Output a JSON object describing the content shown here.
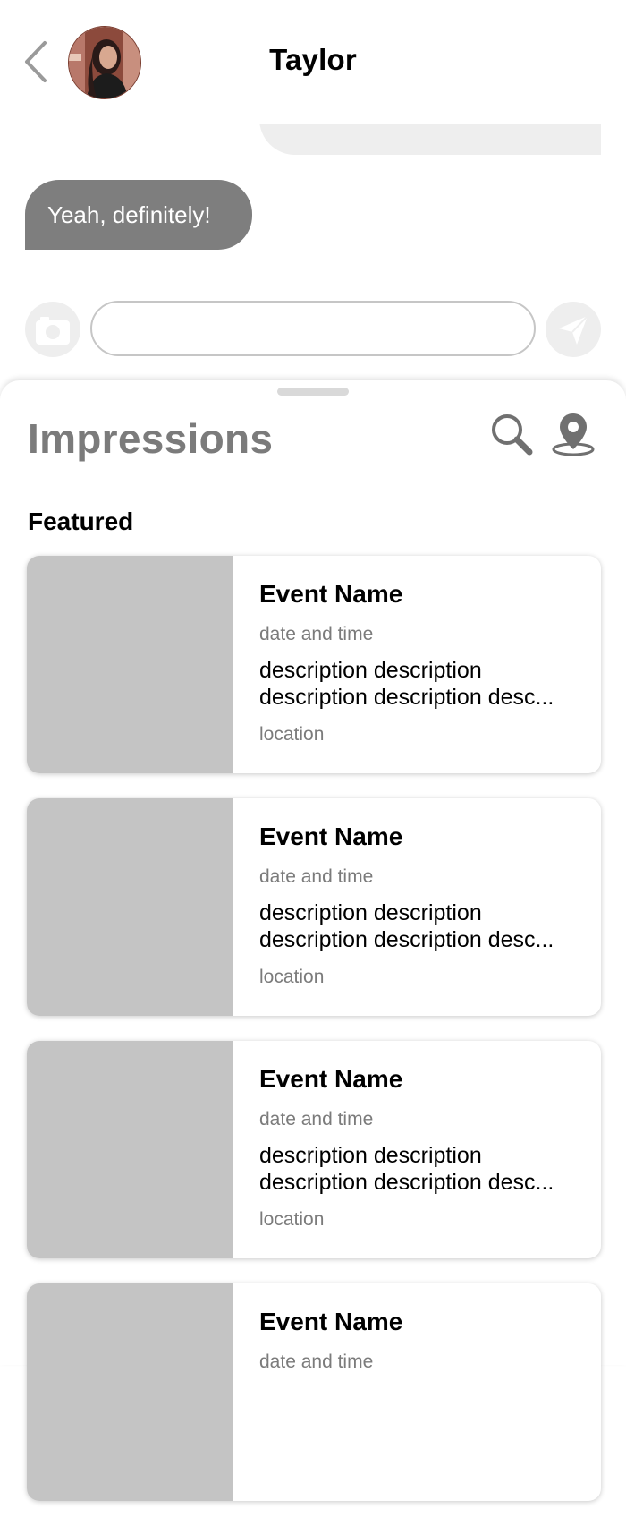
{
  "header": {
    "title": "Taylor",
    "back_icon": "chevron-left-icon",
    "avatar": "profile-photo"
  },
  "chat": {
    "messages": [
      {
        "direction": "outgoing",
        "text": ""
      },
      {
        "direction": "incoming",
        "text": "Yeah, definitely!"
      }
    ],
    "composer": {
      "camera_icon": "camera-icon",
      "input_value": "",
      "input_placeholder": "",
      "send_icon": "paper-plane-icon"
    }
  },
  "sheet": {
    "title": "Impressions",
    "search_icon": "search-icon",
    "map_icon": "map-pin-icon",
    "section_label": "Featured",
    "events": [
      {
        "name": "Event Name",
        "date_time": "date and time",
        "description_line1": "description description",
        "description_line2": "description description desc...",
        "location": "location"
      },
      {
        "name": "Event Name",
        "date_time": "date and time",
        "description_line1": "description description",
        "description_line2": "description description desc...",
        "location": "location"
      },
      {
        "name": "Event Name",
        "date_time": "date and time",
        "description_line1": "description description",
        "description_line2": "description description desc...",
        "location": "location"
      },
      {
        "name": "Event Name",
        "date_time": "date and time",
        "description_line1": "",
        "description_line2": "",
        "location": ""
      }
    ]
  },
  "colors": {
    "incoming_bubble": "#7e7e7e",
    "outgoing_bubble": "#eeeeee",
    "image_placeholder": "#c4c4c4",
    "muted_text": "#7b7b7b",
    "icon_gray": "#707070"
  }
}
